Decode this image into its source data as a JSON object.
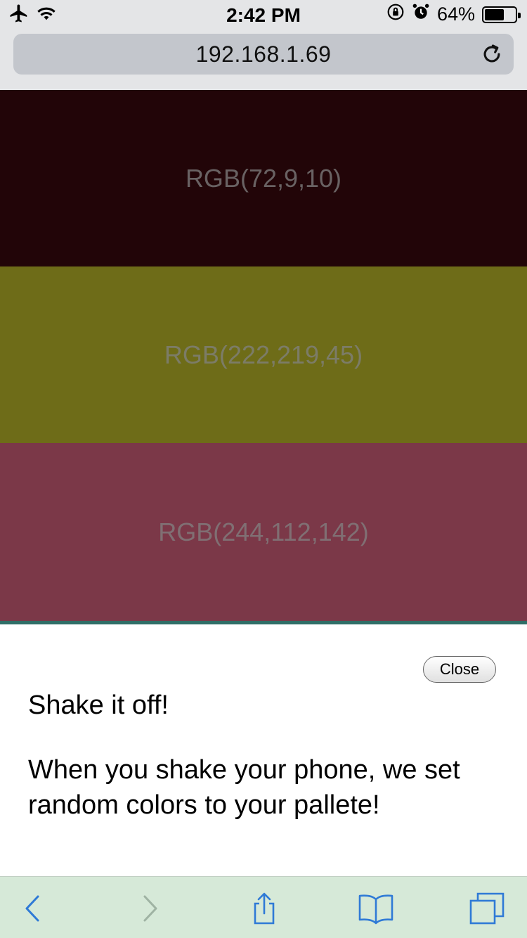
{
  "status_bar": {
    "time": "2:42 PM",
    "battery_percent": "64%",
    "battery_level": 0.64
  },
  "browser": {
    "url": "192.168.1.69"
  },
  "palette": {
    "swatches": [
      {
        "label": "RGB(72,9,10)",
        "color": "#220508"
      },
      {
        "label": "RGB(222,219,45)",
        "color": "#6e6c18"
      },
      {
        "label": "RGB(244,112,142)",
        "color": "#7b3848"
      }
    ]
  },
  "modal": {
    "close_label": "Close",
    "title": "Shake it off!",
    "body": "When you shake your phone, we set random colors to your pallete!"
  },
  "toolbar": {
    "accent_color": "#2f7ad6",
    "disabled_color": "#9fb3a3",
    "icons": [
      "back-icon",
      "forward-icon",
      "share-icon",
      "bookmarks-icon",
      "tabs-icon"
    ]
  }
}
